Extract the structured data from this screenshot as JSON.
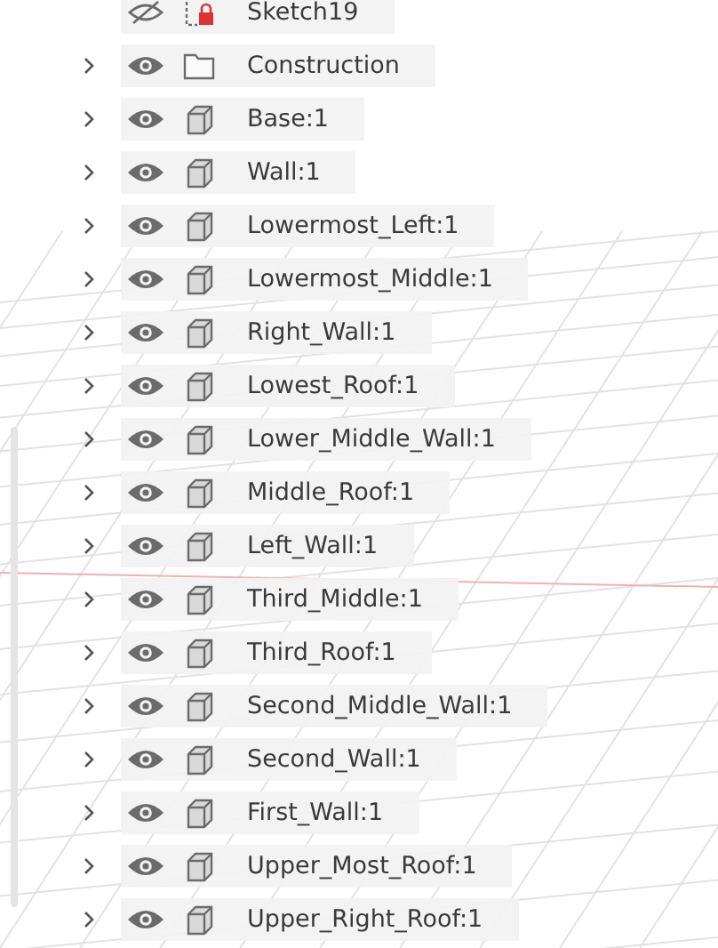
{
  "browser_items": [
    {
      "label": "Sketch19",
      "kind": "sketch",
      "visible": false
    },
    {
      "label": "Construction",
      "kind": "folder",
      "visible": true,
      "expanded": false
    },
    {
      "label": "Base:1",
      "kind": "body",
      "visible": true,
      "expanded": false
    },
    {
      "label": "Wall:1",
      "kind": "body",
      "visible": true,
      "expanded": false
    },
    {
      "label": "Lowermost_Left:1",
      "kind": "body",
      "visible": true,
      "expanded": false
    },
    {
      "label": "Lowermost_Middle:1",
      "kind": "body",
      "visible": true,
      "expanded": false
    },
    {
      "label": "Right_Wall:1",
      "kind": "body",
      "visible": true,
      "expanded": false
    },
    {
      "label": "Lowest_Roof:1",
      "kind": "body",
      "visible": true,
      "expanded": false
    },
    {
      "label": "Lower_Middle_Wall:1",
      "kind": "body",
      "visible": true,
      "expanded": false
    },
    {
      "label": "Middle_Roof:1",
      "kind": "body",
      "visible": true,
      "expanded": false
    },
    {
      "label": "Left_Wall:1",
      "kind": "body",
      "visible": true,
      "expanded": false
    },
    {
      "label": "Third_Middle:1",
      "kind": "body",
      "visible": true,
      "expanded": false
    },
    {
      "label": "Third_Roof:1",
      "kind": "body",
      "visible": true,
      "expanded": false
    },
    {
      "label": "Second_Middle_Wall:1",
      "kind": "body",
      "visible": true,
      "expanded": false
    },
    {
      "label": "Second_Wall:1",
      "kind": "body",
      "visible": true,
      "expanded": false
    },
    {
      "label": "First_Wall:1",
      "kind": "body",
      "visible": true,
      "expanded": false
    },
    {
      "label": "Upper_Most_Roof:1",
      "kind": "body",
      "visible": true,
      "expanded": false
    },
    {
      "label": "Upper_Right_Roof:1",
      "kind": "body",
      "visible": true,
      "expanded": false
    }
  ]
}
